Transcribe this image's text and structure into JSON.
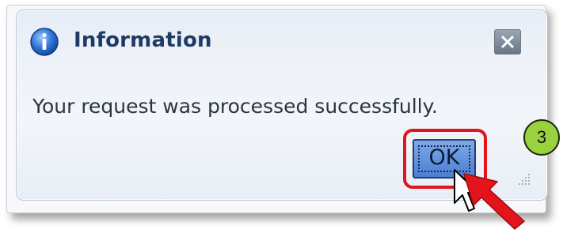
{
  "dialog": {
    "title": "Information",
    "message": "Your request was processed successfully.",
    "ok_label": "OK"
  },
  "annotation": {
    "step_number": "3"
  },
  "icons": {
    "info": "info-icon",
    "close": "close-icon",
    "cursor": "mouse-cursor-icon",
    "arrow": "red-arrow-icon",
    "grip": "resize-grip-icon"
  },
  "colors": {
    "title_text": "#1f3a66",
    "highlight": "#e0151d",
    "step_badge": "#9ad23f",
    "ok_button": "#4a7fd1"
  }
}
